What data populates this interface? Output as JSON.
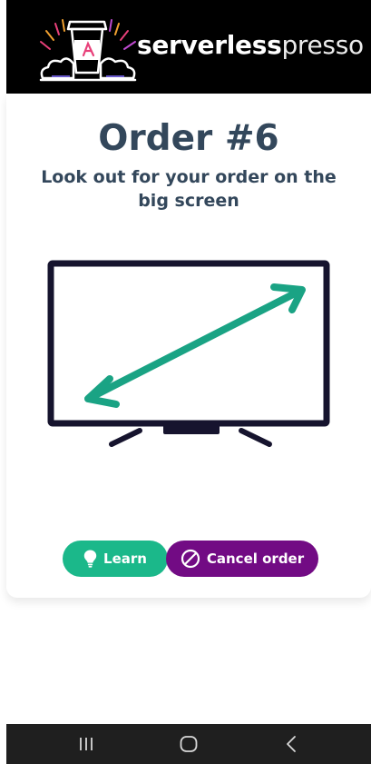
{
  "header": {
    "brand_bold": "serverless",
    "brand_light": "presso"
  },
  "order": {
    "title": "Order #6",
    "message": "Look out for your order on the big screen"
  },
  "buttons": {
    "learn_label": "Learn",
    "cancel_label": "Cancel order"
  },
  "colors": {
    "header_bg": "#000000",
    "title": "#33475b",
    "learn": "#1bb88a",
    "cancel": "#720b84",
    "tv_frame": "#16142e",
    "arrow": "#1aa384",
    "navbar": "#1f1f1f"
  },
  "icons": {
    "learn": "lightbulb-icon",
    "cancel": "cancel-circle-icon",
    "tv": "tv-screen-icon",
    "nav_recent": "recent-apps-icon",
    "nav_home": "home-icon",
    "nav_back": "back-icon"
  }
}
